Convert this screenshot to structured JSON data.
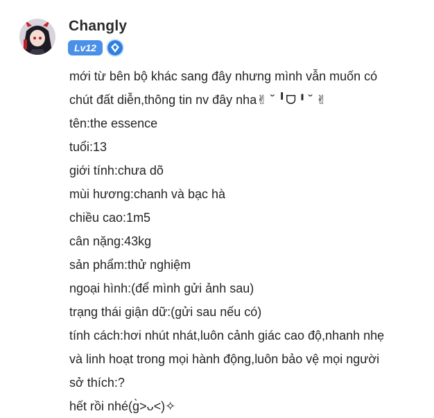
{
  "user": {
    "name": "Changly",
    "level": "Lv12",
    "avatar_icon": "anime-girl-avatar",
    "title_icon": "diamond-badge-icon"
  },
  "post": {
    "lines": [
      "mới từ bên bộ khác sang đây nhưng mình vẫn muốn có",
      "chút đất diễn,thông tin nv đây nha✌︎ ˘ ╹ᗜ╹˘ ✌︎",
      "tên:the essence",
      "tuổi:13",
      "giới tính:chưa dõ",
      "mùi hương:chanh và bạc hà",
      "chiều cao:1m5",
      "cân nặng:43kg",
      "sản phẩm:thử nghiệm",
      "ngoại hình:(để mình gửi ảnh sau)",
      "trạng thái giận dữ:(gửi sau nếu có)",
      "tính cách:hơi nhút nhát,luôn cảnh giác cao độ,nhanh nhẹ",
      "và linh hoạt trong mọi hành động,luôn bảo vệ mọi người",
      "sở thích:?",
      "hết rồi nhé(ɡ̀˃ᴗ˂)✧"
    ]
  }
}
